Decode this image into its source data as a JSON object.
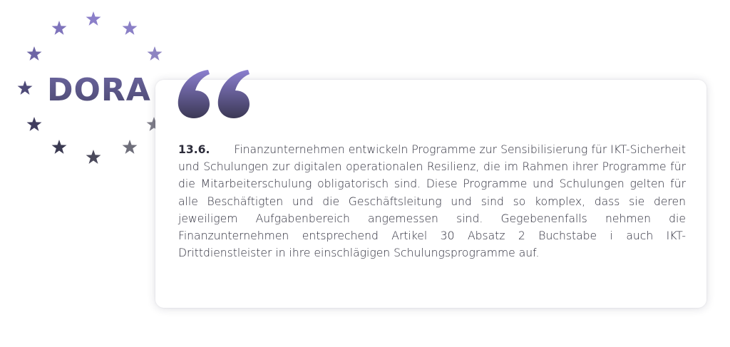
{
  "logo": {
    "text": "DORA",
    "star_colors_top": "#8a7dc4",
    "star_colors_bottom": "#3f3d5c",
    "text_color": "#5f5a86"
  },
  "quote": {
    "icon": "quote-open-icon",
    "icon_color_top": "#8b7fcf",
    "icon_color_bottom": "#3b3855",
    "number": "13.6.",
    "text": "Finanzunternehmen entwickeln Programme zur Sensibilisierung für IKT-Sicherheit und Schulungen zur digitalen operationalen Resilienz, die im Rahmen ihrer Programme für die Mitarbeiterschulung obligatorisch sind. Diese Programme und Schulungen gelten für alle Beschäftigten und die Geschäfts­leitung und sind so komplex, dass sie deren jeweiligem Aufgabenbereich angemessen sind. Gegebenenfalls nehmen die Finanzunternehmen entsprechend Artikel 30 Absatz 2 Buchstabe i auch IKT-Drittdienstleister in ihre einschlägigen Schulungsprogramme auf."
  }
}
